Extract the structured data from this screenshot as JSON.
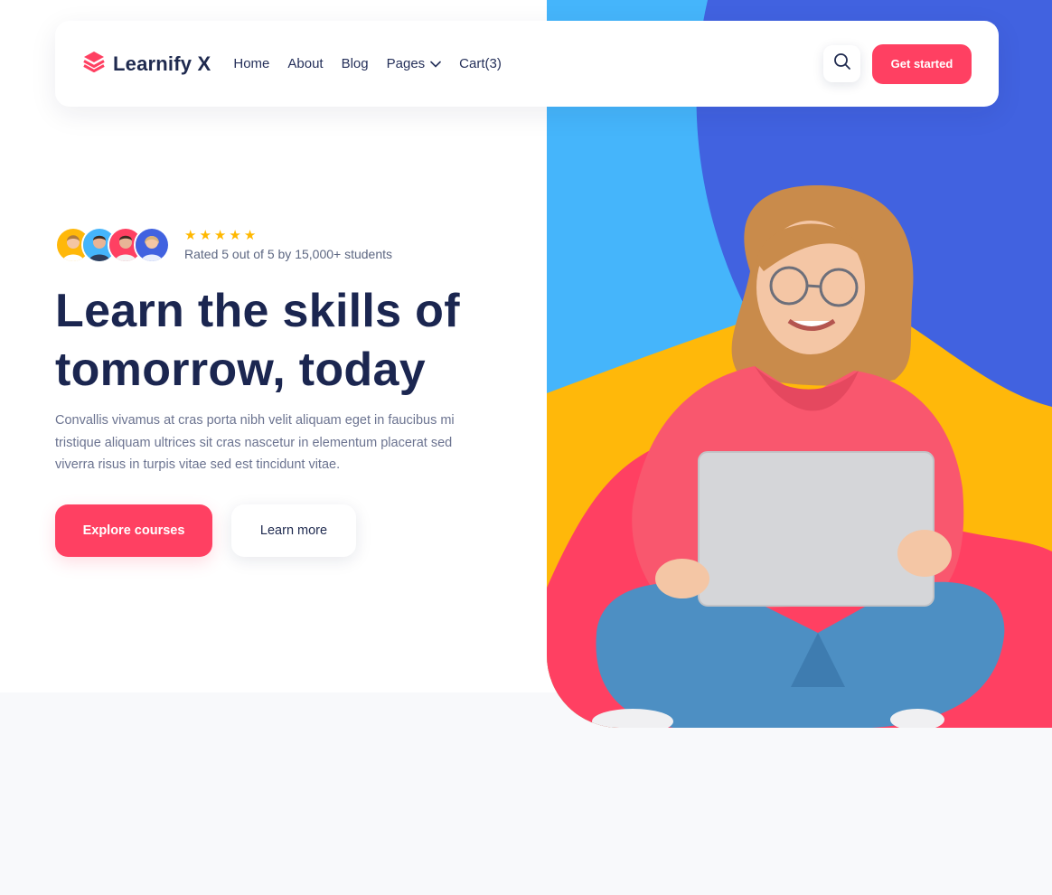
{
  "brand": {
    "name": "Learnify X",
    "accent_color": "#ff4062",
    "logo_icon": "stacked-layers-icon"
  },
  "nav": {
    "links": [
      {
        "label": "Home"
      },
      {
        "label": "About"
      },
      {
        "label": "Blog"
      },
      {
        "label": "Pages",
        "has_dropdown": true
      },
      {
        "label": "Cart(3)"
      }
    ],
    "search_icon": "search-icon",
    "cta_label": "Get started"
  },
  "hero": {
    "rating": {
      "stars": 5,
      "max_stars": 5,
      "text": "Rated 5 out of 5 by 15,000+ students"
    },
    "headline_line1": "Learn the skills of",
    "headline_line2": "tomorrow, today",
    "description": "Convallis vivamus at cras porta nibh velit aliquam eget in faucibus mi tristique aliquam ultrices sit cras nascetur in elementum placerat sed viverra risus in turpis vitae sed est tincidunt vitae.",
    "primary_button": "Explore courses",
    "secondary_button": "Learn more"
  },
  "colors": {
    "blue_light": "#45b5fb",
    "blue_dark": "#4162e0",
    "yellow": "#ffb80a",
    "pink": "#ff4062",
    "navy_text": "#1b2650"
  }
}
